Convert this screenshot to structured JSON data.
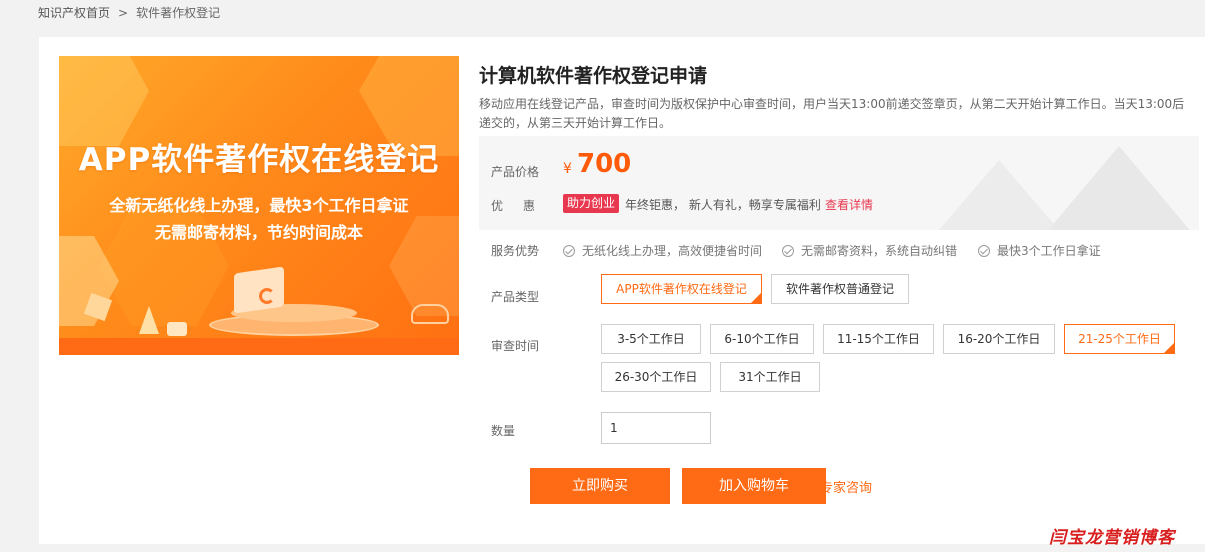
{
  "breadcrumb": {
    "home": "知识产权首页",
    "separator": ">",
    "current": "软件著作权登记"
  },
  "banner": {
    "title": "APP软件著作权在线登记",
    "line1": "全新无纸化线上办理，最快3个工作日拿证",
    "line2": "无需邮寄材料，节约时间成本"
  },
  "product": {
    "title": "计算机软件著作权登记申请",
    "description": "移动应用在线登记产品，审查时间为版权保护中心审查时间，用户当天13:00前递交签章页，从第二天开始计算工作日。当天13:00后递交的，从第三天开始计算工作日。"
  },
  "price": {
    "label": "产品价格",
    "currency": "¥",
    "value": "700"
  },
  "promo": {
    "label": "优惠",
    "badge": "助力创业",
    "text": "年终钜惠， 新人有礼，畅享专属福利",
    "link": "查看详情"
  },
  "advantages": {
    "label": "服务优势",
    "items": [
      "无纸化线上办理，高效便捷省时间",
      "无需邮寄资料，系统自动纠错",
      "最快3个工作日拿证"
    ]
  },
  "product_type": {
    "label": "产品类型",
    "options": [
      "APP软件著作权在线登记",
      "软件著作权普通登记"
    ],
    "selected": "APP软件著作权在线登记"
  },
  "review_time": {
    "label": "审查时间",
    "options": [
      "3-5个工作日",
      "6-10个工作日",
      "11-15个工作日",
      "16-20个工作日",
      "21-25个工作日",
      "26-30个工作日",
      "31个工作日"
    ],
    "selected": "21-25个工作日"
  },
  "quantity": {
    "label": "数量",
    "value": "1"
  },
  "actions": {
    "buy": "立即购买",
    "cart": "加入购物车",
    "consult": "专家咨询"
  },
  "watermark": "闫宝龙营销博客",
  "colors": {
    "accent": "#ff6a14",
    "promo": "#e8384f",
    "watermark": "#d81e1e"
  }
}
